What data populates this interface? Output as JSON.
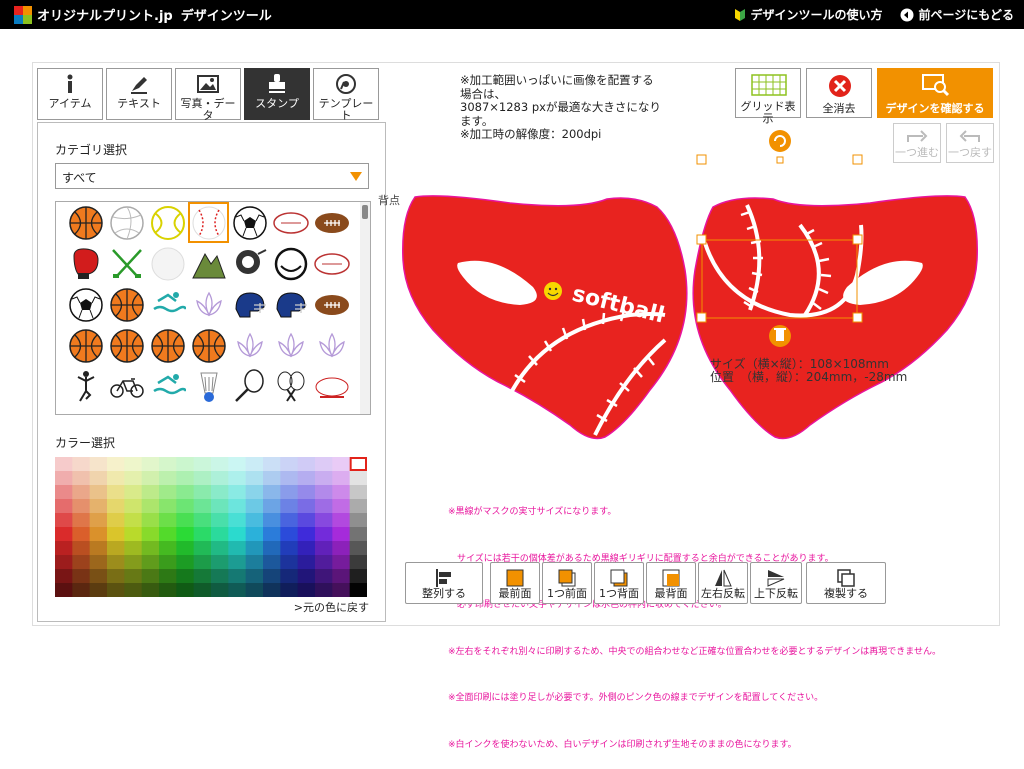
{
  "header": {
    "brand": "オリジナルプリント.jp",
    "subtitle": "デザインツール",
    "nav": [
      {
        "label": "デザインツールの使い方",
        "icon": "beginner-mark-icon"
      },
      {
        "label": "前ページにもどる",
        "icon": "back-arrow-icon"
      }
    ]
  },
  "tabs": [
    {
      "label": "アイテム",
      "icon": "info-icon"
    },
    {
      "label": "テキスト",
      "icon": "pen-icon"
    },
    {
      "label": "写真・データ",
      "icon": "image-icon"
    },
    {
      "label": "スタンプ",
      "icon": "stamp-icon",
      "active": true
    },
    {
      "label": "テンプレート",
      "icon": "template-icon"
    }
  ],
  "panel": {
    "category_label": "カテゴリ選択",
    "category_value": "すべて",
    "color_label": "カラー選択",
    "reset_label": ">元の色に戻す"
  },
  "stamps": [
    "basketball",
    "volleyball",
    "tennis-ball",
    "baseball",
    "soccer-ball",
    "rugby-ball",
    "american-football",
    "boxing-glove",
    "golf-clubs",
    "golf-ball",
    "mountain",
    "golfer",
    "golf-ball-tee",
    "rugby-ball",
    "soccer-ball",
    "basketball",
    "swimmer",
    "lotus",
    "football-helmet",
    "football-helmet",
    "american-football",
    "basketball",
    "basketball",
    "basketball",
    "basketball",
    "lotus",
    "lotus",
    "lotus",
    "yoga",
    "bicycle",
    "swimmer",
    "shuttlecock",
    "badminton-racket",
    "badminton-rackets",
    "rugby-football"
  ],
  "notes": "※加工範囲いっぱいに画像を配置する\n場合は、\n3087×1283 pxが最適な大きさになり\nます。\n※加工時の解像度：200dpi",
  "toolbar": {
    "grid_label": "グリッド表示",
    "clear_label": "全消去",
    "confirm_label": "デザインを確認する",
    "redo_label": "一つ進む",
    "undo_label": "一つ戻す"
  },
  "canvas": {
    "stamp_text": "softball",
    "side_label": "背点",
    "size_label": "サイズ（横×縦）：108×108mm",
    "position_label": "位置　（横，縦）：204mm，-28mm"
  },
  "warnings": [
    "※黒線がマスクの実寸サイズになります。",
    "　サイズには若干の個体差があるため黒線ギリギリに配置すると余白ができることがあります。",
    "　必ず印刷させたい文字やデザインは水色の枠内に収めてください。",
    "※左右をそれぞれ別々に印刷するため、中央での組合わせなど正確な位置合わせを必要とするデザインは再現できません。",
    "※全面印刷には塗り足しが必要です。外側のピンク色の線までデザインを配置してください。",
    "※白インクを使わないため、白いデザインは印刷されず生地そのままの色になります。"
  ],
  "bottom_tools": [
    {
      "label": "整列する",
      "icon": "align-icon"
    },
    {
      "label": "最前面",
      "icon": "bring-front-icon"
    },
    {
      "label": "1つ前面",
      "icon": "bring-forward-icon"
    },
    {
      "label": "1つ背面",
      "icon": "send-backward-icon"
    },
    {
      "label": "最背面",
      "icon": "send-back-icon"
    },
    {
      "label": "左右反転",
      "icon": "flip-horizontal-icon"
    },
    {
      "label": "上下反転",
      "icon": "flip-vertical-icon"
    },
    {
      "label": "複製する",
      "icon": "duplicate-icon"
    }
  ],
  "colors": {
    "accent": "#f29100",
    "mask_red": "#e8231f",
    "bleed_pink": "#e8149d",
    "warning_text": "#e8149d",
    "clear_red": "#e2231a",
    "grid_green": "#8dc21f"
  }
}
